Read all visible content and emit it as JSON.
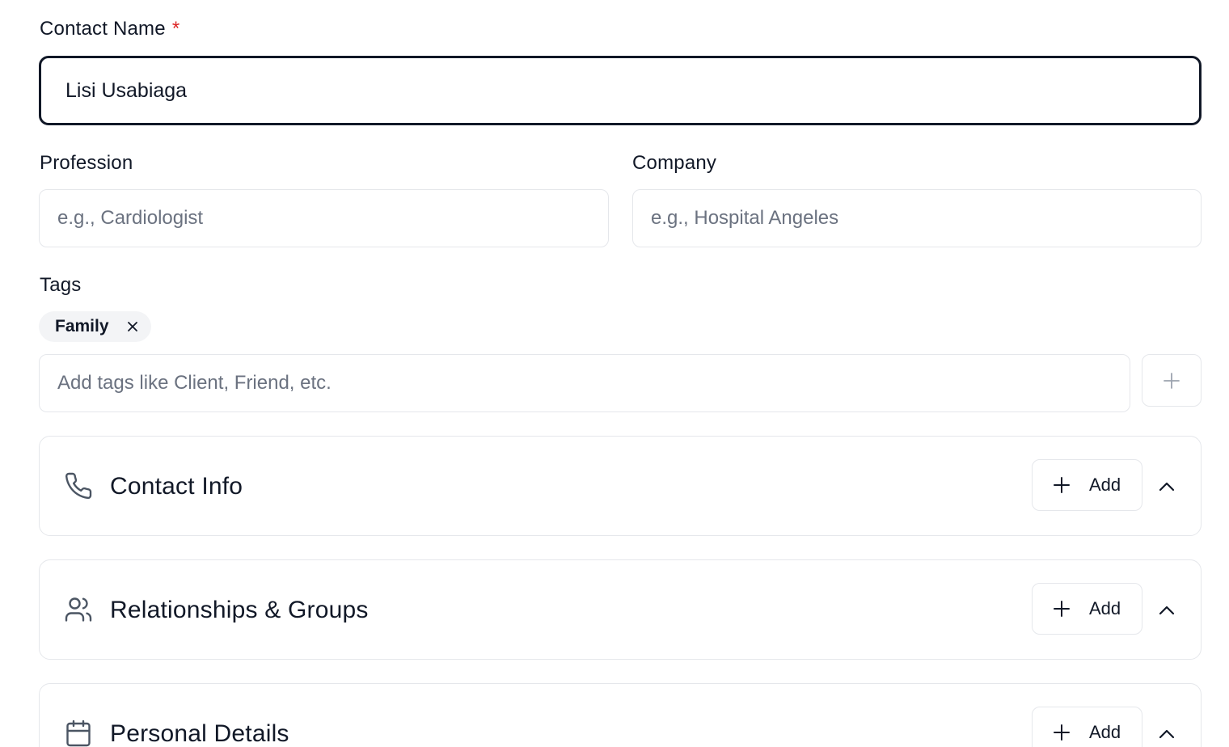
{
  "contact_name": {
    "label": "Contact Name",
    "required_mark": "*",
    "value": "Lisi Usabiaga"
  },
  "profession": {
    "label": "Profession",
    "placeholder": "e.g., Cardiologist"
  },
  "company": {
    "label": "Company",
    "placeholder": "e.g., Hospital Angeles"
  },
  "tags": {
    "label": "Tags",
    "items": [
      {
        "label": "Family",
        "remove_icon": "close-icon"
      }
    ],
    "input_placeholder": "Add tags like Client, Friend, etc.",
    "add_icon": "plus-icon"
  },
  "sections": [
    {
      "title": "Contact Info",
      "icon": "phone-icon",
      "add_label": "Add",
      "expanded": true
    },
    {
      "title": "Relationships & Groups",
      "icon": "users-icon",
      "add_label": "Add",
      "expanded": true
    },
    {
      "title": "Personal Details",
      "icon": "calendar-icon",
      "add_label": "Add",
      "expanded": true
    }
  ],
  "colors": {
    "text": "#111827",
    "placeholder": "#6b7280",
    "border": "#e5e7eb",
    "focus_border": "#111827",
    "required": "#dc2626",
    "chip_bg": "#f3f4f6"
  }
}
